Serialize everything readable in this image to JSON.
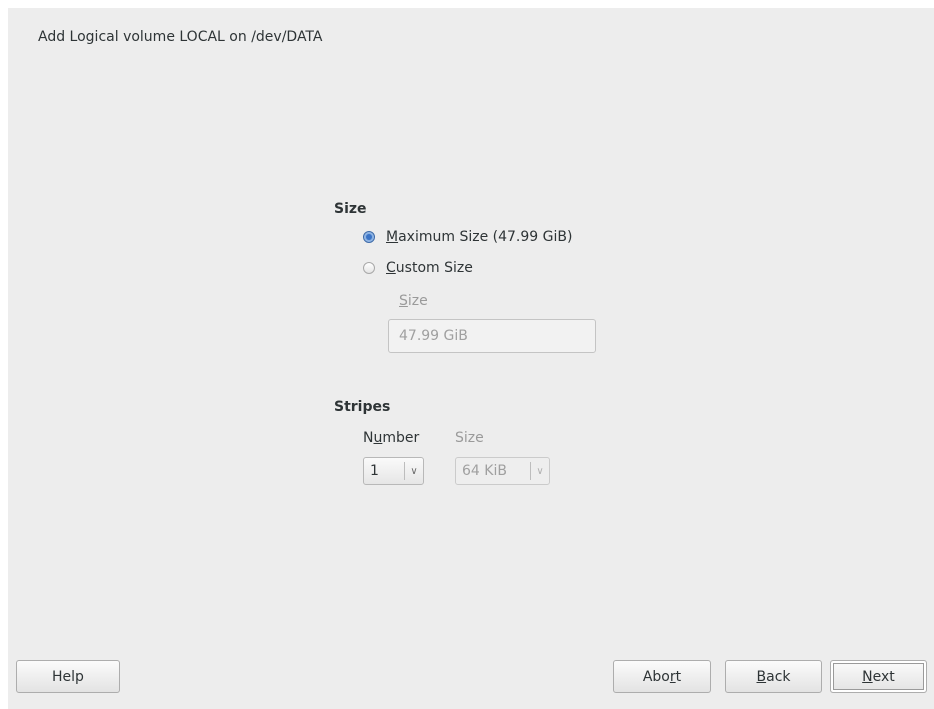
{
  "dialog": {
    "title": "Add Logical volume LOCAL on /dev/DATA"
  },
  "size_section": {
    "heading": "Size",
    "options": [
      {
        "label_prefix": "",
        "label_mnemonic": "M",
        "label_rest": "aximum Size (47.99 GiB)",
        "selected": true
      },
      {
        "label_prefix": "",
        "label_mnemonic": "C",
        "label_rest": "ustom Size",
        "selected": false
      }
    ],
    "custom_size_label_mnemonic": "S",
    "custom_size_label_rest": "ize",
    "custom_size_value": "47.99 GiB"
  },
  "stripes_section": {
    "heading": "Stripes",
    "number_label_prefix": "N",
    "number_label_mnemonic": "u",
    "number_label_rest": "mber",
    "number_value": "1",
    "size_label": "Size",
    "size_value": "64 KiB"
  },
  "buttons": {
    "help": "Help",
    "abort_prefix": "Abo",
    "abort_mnemonic": "r",
    "abort_rest": "t",
    "back_mnemonic": "B",
    "back_rest": "ack",
    "next_mnemonic": "N",
    "next_rest": "ext"
  },
  "colors": {
    "window_bg": "#ededed",
    "radio_selected": "#3b74c6"
  }
}
